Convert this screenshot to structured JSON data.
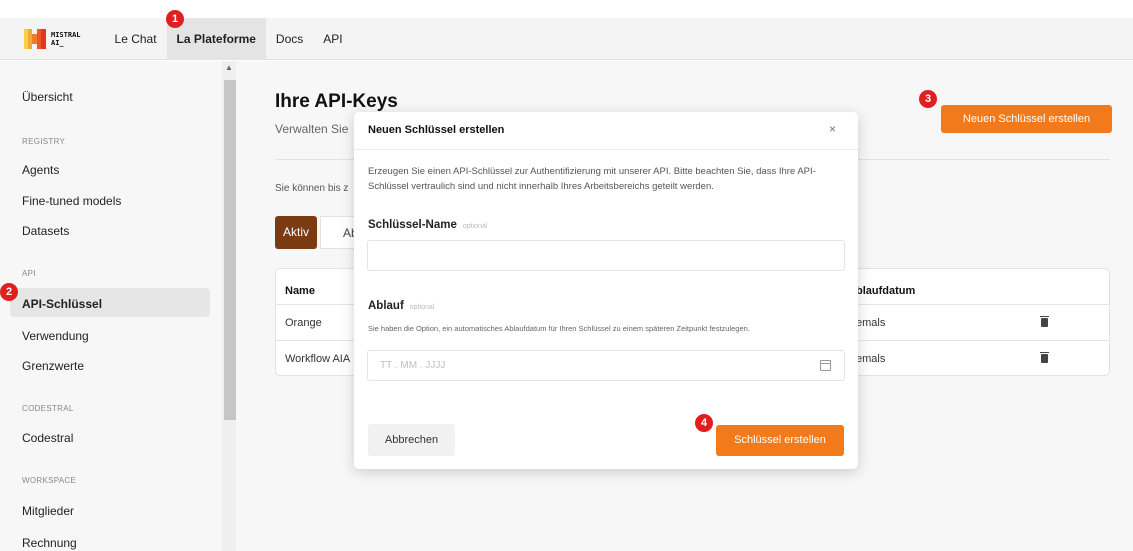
{
  "topnav": {
    "logo_text_line1": "MISTRAL",
    "logo_text_line2": "AI_",
    "items": [
      {
        "label": "Le Chat"
      },
      {
        "label": "La Plateforme"
      },
      {
        "label": "Docs"
      },
      {
        "label": "API"
      }
    ]
  },
  "sidebar": {
    "overview": "Übersicht",
    "section_registry": "REGISTRY",
    "agents": "Agents",
    "fine_tuned": "Fine-tuned models",
    "datasets": "Datasets",
    "section_api": "API",
    "api_keys": "API-Schlüssel",
    "usage": "Verwendung",
    "limits": "Grenzwerte",
    "section_codestral": "CODESTRAL",
    "codestral": "Codestral",
    "section_workspace": "WORKSPACE",
    "members": "Mitglieder",
    "billing": "Rechnung"
  },
  "main": {
    "title": "Ihre API-Keys",
    "subtitle": "Verwalten Sie",
    "info": "Sie können bis z",
    "tab_active": "Aktiv",
    "tab_other": "Ab",
    "create_button": "Neuen Schlüssel erstellen",
    "table": {
      "col_name": "Name",
      "col_expiry": "blaufdatum",
      "rows": [
        {
          "name": "Orange",
          "expiry": "emals"
        },
        {
          "name": "Workflow AIA",
          "expiry": "emals"
        }
      ]
    }
  },
  "modal": {
    "title": "Neuen Schlüssel erstellen",
    "close_glyph": "×",
    "description": "Erzeugen Sie einen API-Schlüssel zur Authentifizierung mit unserer API. Bitte beachten Sie, dass Ihre API-Schlüssel vertraulich sind und nicht innerhalb Ihres Arbeitsbereichs geteilt werden.",
    "name_label": "Schlüssel-Name",
    "name_optional": "optional",
    "name_value": "",
    "expiry_label": "Ablauf",
    "expiry_optional": "optional",
    "expiry_hint": "Sie haben die Option, ein automatisches Ablaufdatum für Ihren Schlüssel zu einem späteren Zeitpunkt festzulegen.",
    "date_placeholder": "TT . MM . JJJJ",
    "cancel_button": "Abbrechen",
    "create_button": "Schlüssel erstellen"
  },
  "badges": [
    "1",
    "2",
    "3",
    "4"
  ],
  "colors": {
    "accent": "#f27a1a",
    "active_tab": "#7a3b12",
    "badge": "#e0201f"
  }
}
